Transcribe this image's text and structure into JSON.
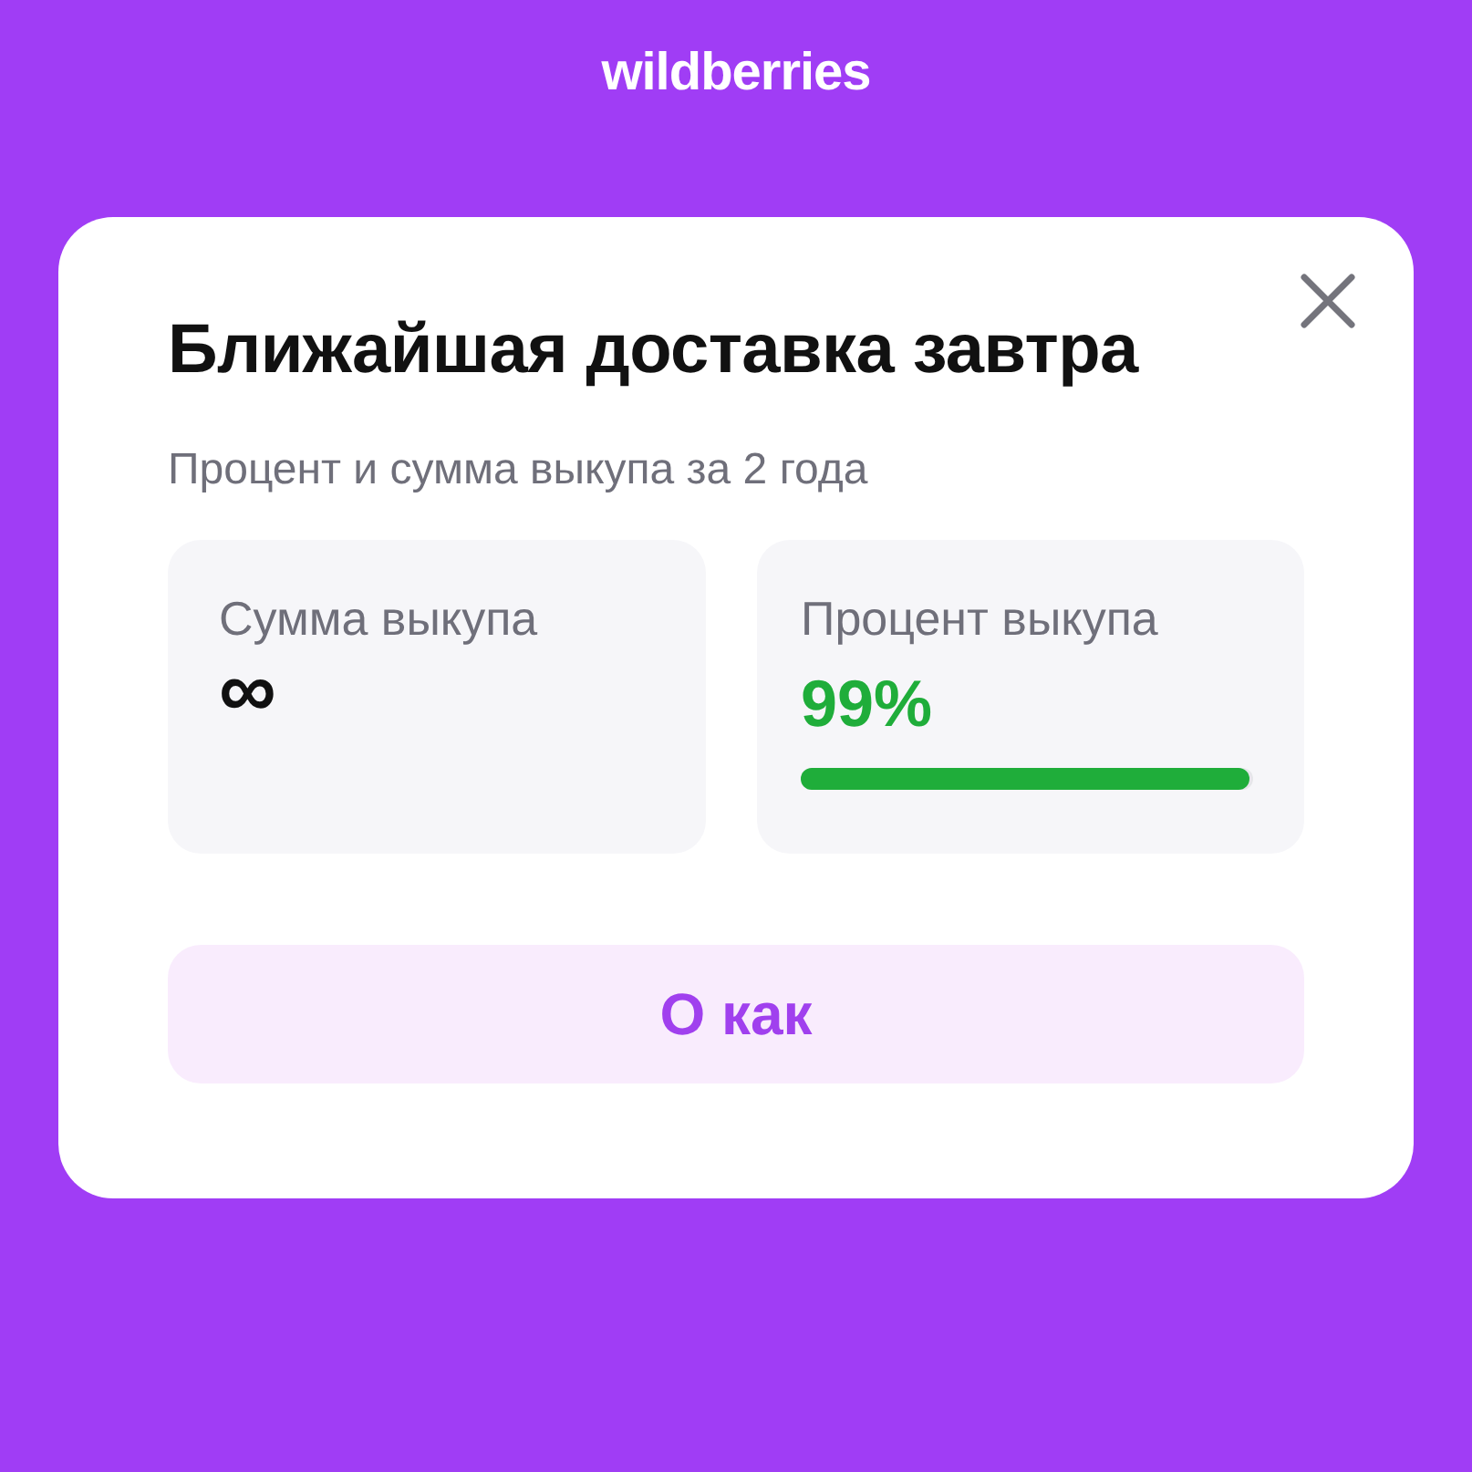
{
  "logo": "wildberries",
  "dialog": {
    "title": "Ближайшая доставка завтра",
    "subtitle": "Процент и сумма выкупа за 2 года",
    "cards": [
      {
        "kind": "plain",
        "label": "Сумма выкупа",
        "value": "∞"
      },
      {
        "kind": "progress",
        "label": "Процент выкупа",
        "value": "99%",
        "level": 0.99
      }
    ],
    "button": "О как"
  }
}
